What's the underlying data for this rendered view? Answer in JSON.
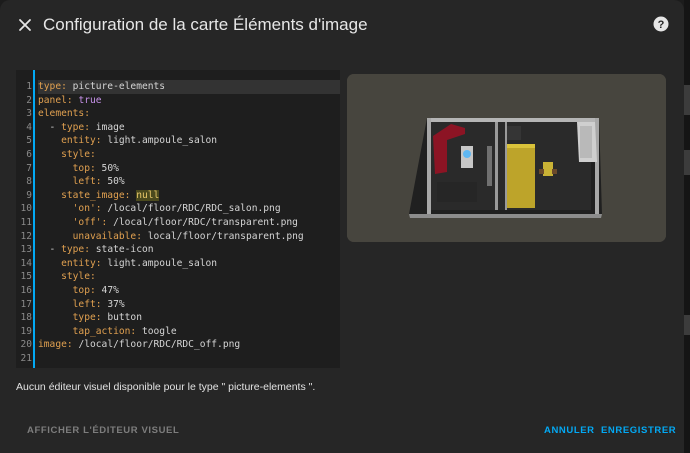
{
  "dialog": {
    "title": "Configuration de la carte Éléments d'image"
  },
  "editor": {
    "line_numbers": [
      "1",
      "2",
      "3",
      "4",
      "5",
      "6",
      "7",
      "8",
      "9",
      "10",
      "11",
      "12",
      "13",
      "14",
      "15",
      "16",
      "17",
      "18",
      "19",
      "20",
      "21"
    ],
    "lines": [
      [
        {
          "t": "type: ",
          "c": "k"
        },
        {
          "t": "picture-elements",
          "c": ""
        }
      ],
      [
        {
          "t": "panel: ",
          "c": "k"
        },
        {
          "t": "true",
          "c": "b"
        }
      ],
      [
        {
          "t": "elements:",
          "c": "k"
        }
      ],
      [
        {
          "t": "  - ",
          "c": ""
        },
        {
          "t": "type: ",
          "c": "k"
        },
        {
          "t": "image",
          "c": ""
        }
      ],
      [
        {
          "t": "    entity: ",
          "c": "k"
        },
        {
          "t": "light.ampoule_salon",
          "c": ""
        }
      ],
      [
        {
          "t": "    style:",
          "c": "k"
        }
      ],
      [
        {
          "t": "      top: ",
          "c": "k"
        },
        {
          "t": "50%",
          "c": ""
        }
      ],
      [
        {
          "t": "      left: ",
          "c": "k"
        },
        {
          "t": "50%",
          "c": ""
        }
      ],
      [
        {
          "t": "    state_image: ",
          "c": "k"
        },
        {
          "t": "null",
          "c": "n hl"
        }
      ],
      [
        {
          "t": "      'on': ",
          "c": "k"
        },
        {
          "t": "/local/floor/RDC/RDC_salon.png",
          "c": ""
        }
      ],
      [
        {
          "t": "      'off': ",
          "c": "k"
        },
        {
          "t": "/local/floor/RDC/transparent.png",
          "c": ""
        }
      ],
      [
        {
          "t": "      unavailable: ",
          "c": "k"
        },
        {
          "t": "local/floor/transparent.png",
          "c": ""
        }
      ],
      [
        {
          "t": "  - ",
          "c": ""
        },
        {
          "t": "type: ",
          "c": "k"
        },
        {
          "t": "state-icon",
          "c": ""
        }
      ],
      [
        {
          "t": "    entity: ",
          "c": "k"
        },
        {
          "t": "light.ampoule_salon",
          "c": ""
        }
      ],
      [
        {
          "t": "    style:",
          "c": "k"
        }
      ],
      [
        {
          "t": "      top: ",
          "c": "k"
        },
        {
          "t": "47%",
          "c": ""
        }
      ],
      [
        {
          "t": "      left: ",
          "c": "k"
        },
        {
          "t": "37%",
          "c": ""
        }
      ],
      [
        {
          "t": "      type: ",
          "c": "k"
        },
        {
          "t": "button",
          "c": ""
        }
      ],
      [
        {
          "t": "      tap_action: ",
          "c": "k"
        },
        {
          "t": "toogle",
          "c": ""
        }
      ],
      [
        {
          "t": "image: ",
          "c": "k"
        },
        {
          "t": "/local/floor/RDC/RDC_off.png",
          "c": ""
        }
      ],
      [
        {
          "t": "",
          "c": ""
        }
      ]
    ]
  },
  "info_text": "Aucun éditeur visuel disponible pour le type \" picture-elements \".",
  "footer": {
    "visual_editor_label": "AFFICHER L'ÉDITEUR VISUEL",
    "cancel_label": "ANNULER",
    "save_label": "ENREGISTRER"
  },
  "colors": {
    "accent": "#03a9f4",
    "key": "#e0a050",
    "boolean": "#c792ea",
    "null": "#e8c86a"
  }
}
